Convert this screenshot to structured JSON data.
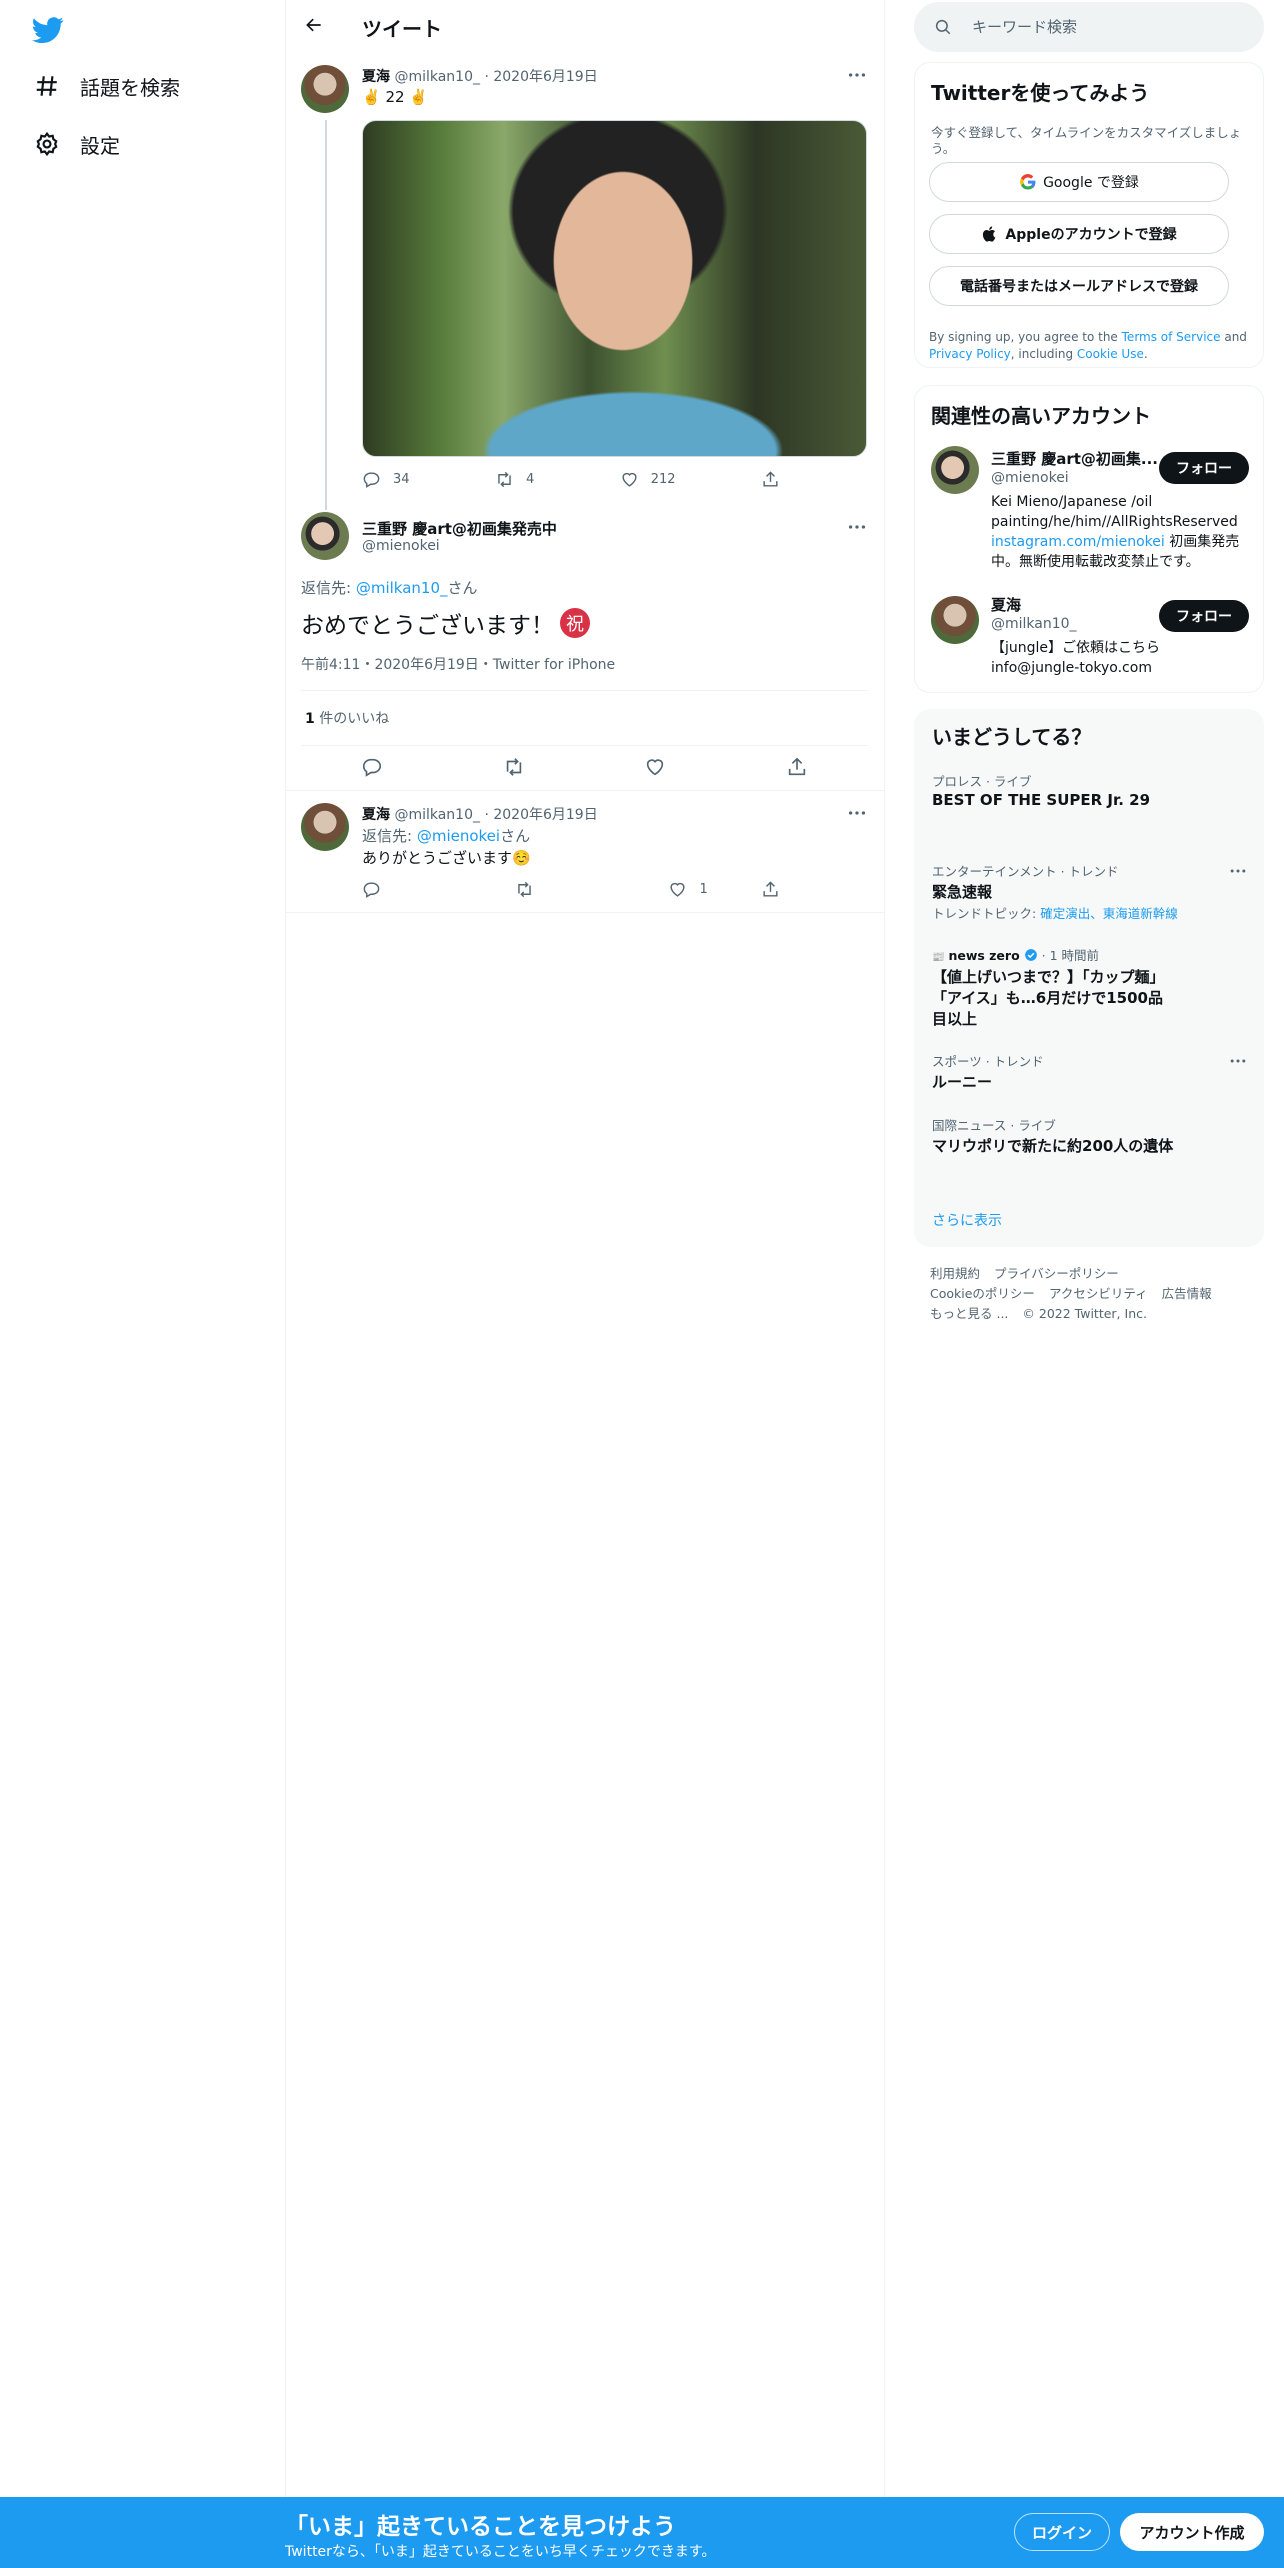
{
  "nav": {
    "items": [
      {
        "label": "話題を検索",
        "icon": "hashtag-icon"
      },
      {
        "label": "設定",
        "icon": "gear-icon"
      }
    ]
  },
  "header": {
    "title": "ツイート"
  },
  "tweet1": {
    "name": "夏海",
    "handle": "@milkan10_",
    "date": "2020年6月19日",
    "text": "22",
    "emoji": "✌️",
    "counts": {
      "reply": "34",
      "retweet": "4",
      "like": "212"
    }
  },
  "main_tweet": {
    "name": "三重野 慶art@初画集発売中",
    "handle": "@mienokei",
    "reply_prefix": "返信先: ",
    "reply_to": "@milkan10_",
    "reply_suffix": "さん",
    "text": "おめでとうございます！",
    "emoji": "祝",
    "meta": "午前4:11・2020年6月19日・Twitter for iPhone",
    "likes_count": "1",
    "likes_label": "件のいいね"
  },
  "reply_tweet": {
    "name": "夏海",
    "handle": "@milkan10_",
    "date": "2020年6月19日",
    "reply_prefix": "返信先: ",
    "reply_to": "@mienokei",
    "reply_suffix": "さん",
    "text": "ありがとうございます☺️",
    "counts": {
      "reply": "",
      "retweet": "",
      "like": "1"
    }
  },
  "search": {
    "placeholder": "キーワード検索"
  },
  "signup": {
    "title": "Twitterを使ってみよう",
    "subtitle": "今すぐ登録して、タイムラインをカスタマイズしましょう。",
    "google": "Google で登録",
    "apple": "Appleのアカウントで登録",
    "phone": "電話番号またはメールアドレスで登録",
    "terms_1": "By signing up, you agree to the ",
    "terms_link1": "Terms of Service",
    "terms_2": " and ",
    "terms_link2": "Privacy Policy",
    "terms_3": ", including ",
    "terms_link3": "Cookie Use",
    "terms_4": "."
  },
  "related": {
    "title": "関連性の高いアカウント",
    "follow_label": "フォロー",
    "accounts": [
      {
        "name": "三重野 慶art@初画集...",
        "handle": "@mienokei",
        "bio_1": "Kei Mieno/Japanese /oil painting/he/him//AllRightsReserved ",
        "bio_link": "instagram.com/mienokei",
        "bio_2": " 初画集発売中。無断使用転載改変禁止です。"
      },
      {
        "name": "夏海",
        "handle": "@milkan10_",
        "bio_1": "【jungle】ご依頼はこちら info@jungle-tokyo.com"
      }
    ]
  },
  "trends": {
    "title": "いまどうしてる？",
    "items": [
      {
        "category": "プロレス · ライブ",
        "name": "BEST OF THE SUPER Jr. 29"
      },
      {
        "category": "エンターテインメント · トレンド",
        "name": "緊急速報",
        "sub_label": "トレンドトピック: ",
        "sub_links": "確定演出、東海道新幹線"
      },
      {
        "source": "news zero",
        "time": " · 1 時間前",
        "name": "【値上げいつまで？】「カップ麺」「アイス」も…6月だけで1500品目以上"
      },
      {
        "category": "スポーツ · トレンド",
        "name": "ルーニー"
      },
      {
        "category": "国際ニュース · ライブ",
        "name": "マリウポリで新たに約200人の遺体"
      }
    ],
    "show_more": "さらに表示"
  },
  "footer": {
    "links_row1": [
      "利用規約",
      "プライバシーポリシー"
    ],
    "links_row2": [
      "Cookieのポリシー",
      "アクセシビリティ",
      "広告情報"
    ],
    "more": "もっと見る ...",
    "copyright": "© 2022 Twitter, Inc."
  },
  "bottom_bar": {
    "title": "「いま」起きていることを見つけよう",
    "subtitle": "Twitterなら、「いま」起きていることをいち早くチェックできます。",
    "login": "ログイン",
    "signup": "アカウント作成"
  },
  "colors": {
    "brand": "#1d9bf0",
    "text": "#0f1419",
    "muted": "#536471"
  }
}
